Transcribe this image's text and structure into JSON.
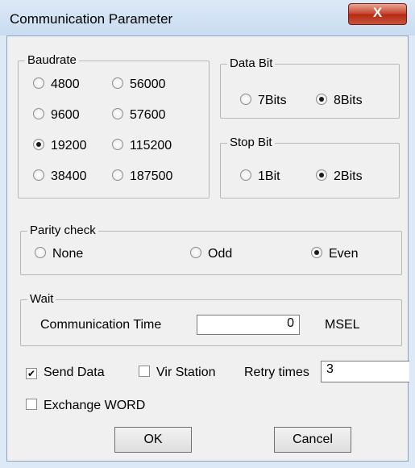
{
  "window": {
    "title": "Communication Parameter",
    "close_glyph": "X"
  },
  "baudrate": {
    "label": "Baudrate",
    "options": [
      "4800",
      "56000",
      "9600",
      "57600",
      "19200",
      "115200",
      "38400",
      "187500"
    ],
    "selected": "19200"
  },
  "data_bit": {
    "label": "Data Bit",
    "options": [
      "7Bits",
      "8Bits"
    ],
    "selected": "8Bits"
  },
  "stop_bit": {
    "label": "Stop Bit",
    "options": [
      "1Bit",
      "2Bits"
    ],
    "selected": "2Bits"
  },
  "parity": {
    "label": "Parity check",
    "options": [
      "None",
      "Odd",
      "Even"
    ],
    "selected": "Even"
  },
  "wait": {
    "label": "Wait",
    "time_label": "Communication Time",
    "time_value": "0",
    "unit": "MSEL"
  },
  "options": {
    "send_data": {
      "label": "Send Data",
      "checked": true
    },
    "vir_station": {
      "label": "Vir Station",
      "checked": false
    },
    "retry_label": "Retry times",
    "retry_value": "3",
    "exchange_word": {
      "label": "Exchange WORD",
      "checked": false
    }
  },
  "buttons": {
    "ok": "OK",
    "cancel": "Cancel"
  }
}
